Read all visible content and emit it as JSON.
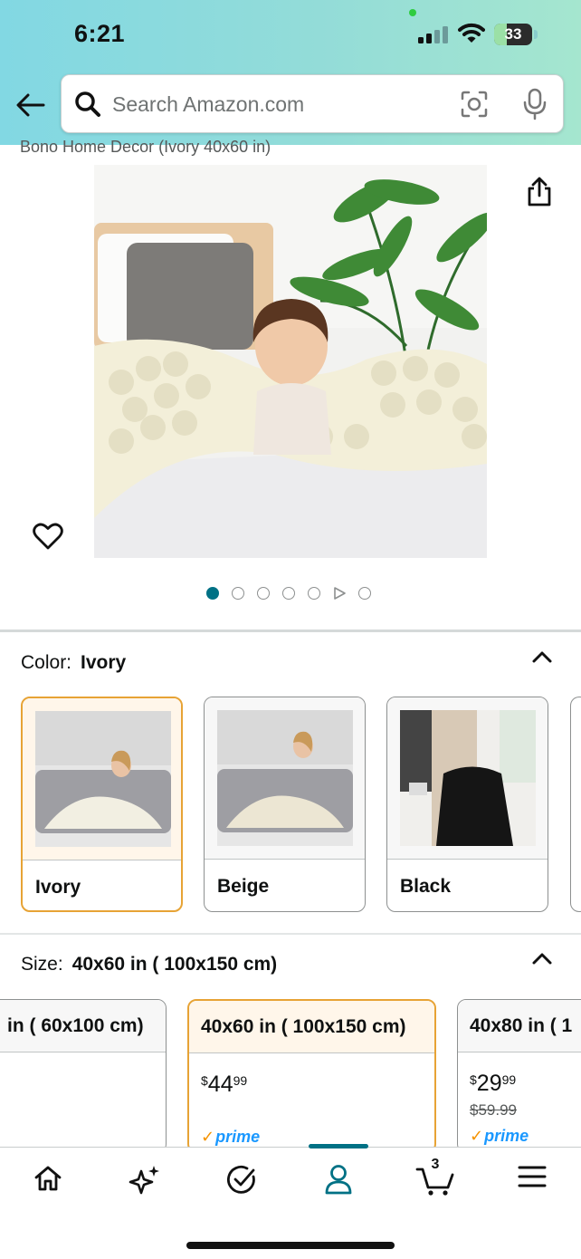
{
  "status_bar": {
    "time": "6:21",
    "battery": "33"
  },
  "search": {
    "placeholder": "Search Amazon.com"
  },
  "product": {
    "title_fragment": "Bono Home Decor (Ivory 40x60 in)",
    "image_count": 7,
    "active_image_index": 0
  },
  "color": {
    "label": "Color:",
    "selected": "Ivory",
    "options": [
      {
        "label": "Ivory"
      },
      {
        "label": "Beige"
      },
      {
        "label": "Black"
      }
    ]
  },
  "size": {
    "label": "Size:",
    "selected": "40x60 in ( 100x150 cm)",
    "options": [
      {
        "label": "in ( 60x100 cm)"
      },
      {
        "label": "40x60 in ( 100x150 cm)",
        "currency": "$",
        "price_whole": "44",
        "price_fraction": "99",
        "prime": "prime"
      },
      {
        "label": "40x80 in ( 1",
        "currency": "$",
        "price_whole": "29",
        "price_fraction": "99",
        "list_price": "$59.99",
        "prime": "prime"
      }
    ]
  },
  "tabbar": {
    "items": [
      "home",
      "rufus",
      "deals",
      "account",
      "cart",
      "menu"
    ],
    "active": "account",
    "cart_count": "3"
  },
  "colors": {
    "accent": "#007185",
    "selected_border": "#e7a335",
    "prime_blue": "#1a98ff"
  }
}
